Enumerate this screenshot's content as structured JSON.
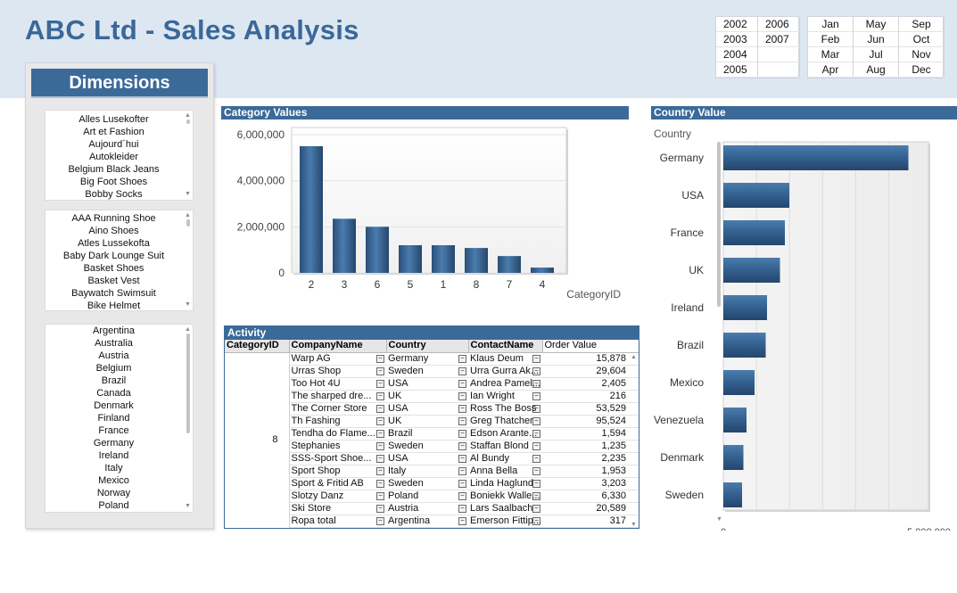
{
  "app": {
    "title": "ABC Ltd - Sales Analysis"
  },
  "years": [
    "2002",
    "2006",
    "2003",
    "2007",
    "2004",
    "",
    "2005",
    ""
  ],
  "months": [
    "Jan",
    "May",
    "Sep",
    "Feb",
    "Jun",
    "Oct",
    "Mar",
    "Jul",
    "Nov",
    "Apr",
    "Aug",
    "Dec"
  ],
  "dimensions": {
    "title": "Dimensions",
    "companies": [
      "Alles Lusekofter",
      "Art et Fashion",
      "Aujourd´hui",
      "Autokleider",
      "Belgium Black Jeans",
      "Big Foot Shoes",
      "Bobby Socks"
    ],
    "products": [
      "AAA Running Shoe",
      "Aino Shoes",
      "Atles Lussekofta",
      "Baby Dark Lounge Suit",
      "Basket Shoes",
      "Basket Vest",
      "Baywatch Swimsuit",
      "Bike Helmet"
    ],
    "countries": [
      "Argentina",
      "Australia",
      "Austria",
      "Belgium",
      "Brazil",
      "Canada",
      "Denmark",
      "Finland",
      "France",
      "Germany",
      "Ireland",
      "Italy",
      "Mexico",
      "Norway",
      "Poland"
    ]
  },
  "category_values": {
    "title": "Category Values"
  },
  "country_value": {
    "title": "Country Value"
  },
  "chart_data": [
    {
      "type": "bar",
      "title": "Category Values",
      "xlabel": "CategoryID",
      "ylabel": "",
      "categories": [
        "2",
        "3",
        "6",
        "5",
        "1",
        "8",
        "7",
        "4"
      ],
      "values": [
        5500000,
        2350000,
        2000000,
        1200000,
        1200000,
        1080000,
        730000,
        230000
      ],
      "ylim": [
        0,
        6000000
      ],
      "yticks": [
        "0",
        "2,000,000",
        "4,000,000",
        "6,000,000"
      ],
      "color": "#3b6a99",
      "grid": true
    },
    {
      "type": "bar",
      "orientation": "horizontal",
      "title": "Country Value",
      "ylabel": "Country",
      "categories": [
        "Germany",
        "USA",
        "France",
        "UK",
        "Ireland",
        "Brazil",
        "Mexico",
        "Venezuela",
        "Denmark",
        "Sweden"
      ],
      "values": [
        4150000,
        1480000,
        1380000,
        1270000,
        980000,
        950000,
        700000,
        520000,
        450000,
        420000
      ],
      "xlim": [
        0,
        5000000
      ],
      "xticks": [
        "0",
        "5,000,000"
      ],
      "color": "#3b6a99",
      "grid": true
    }
  ],
  "activity": {
    "title": "Activity",
    "headers": [
      "CategoryID",
      "CompanyName",
      "Country",
      "ContactName",
      "Order Value"
    ],
    "category": "8",
    "rows": [
      [
        "Warp AG",
        "Germany",
        "Klaus Deum",
        "15,878"
      ],
      [
        "Urras Shop",
        "Sweden",
        "Urra Gurra Ak...",
        "29,604"
      ],
      [
        "Too Hot 4U",
        "USA",
        "Andrea Pamel...",
        "2,405"
      ],
      [
        "The sharped dre...",
        "UK",
        "Ian Wright",
        "216"
      ],
      [
        "The Corner Store",
        "USA",
        "Ross The Boss",
        "53,529"
      ],
      [
        "Th Fashing",
        "UK",
        "Greg Thatcher",
        "95,524"
      ],
      [
        "Tendha do Flame...",
        "Brazil",
        "Edson Arante...",
        "1,594"
      ],
      [
        "Stephanies",
        "Sweden",
        "Staffan Blond",
        "1,235"
      ],
      [
        "SSS-Sport Shoe...",
        "USA",
        "Al Bundy",
        "2,235"
      ],
      [
        "Sport Shop",
        "Italy",
        "Anna Bella",
        "1,953"
      ],
      [
        "Sport & Fritid AB",
        "Sweden",
        "Linda Haglund",
        "3,203"
      ],
      [
        "Slotzy Danz",
        "Poland",
        "Boniekk Walle...",
        "6,330"
      ],
      [
        "Ski Store",
        "Austria",
        "Lars Saalbach",
        "20,589"
      ],
      [
        "Ropa total",
        "Argentina",
        "Emerson Fittip...",
        "317"
      ]
    ]
  }
}
